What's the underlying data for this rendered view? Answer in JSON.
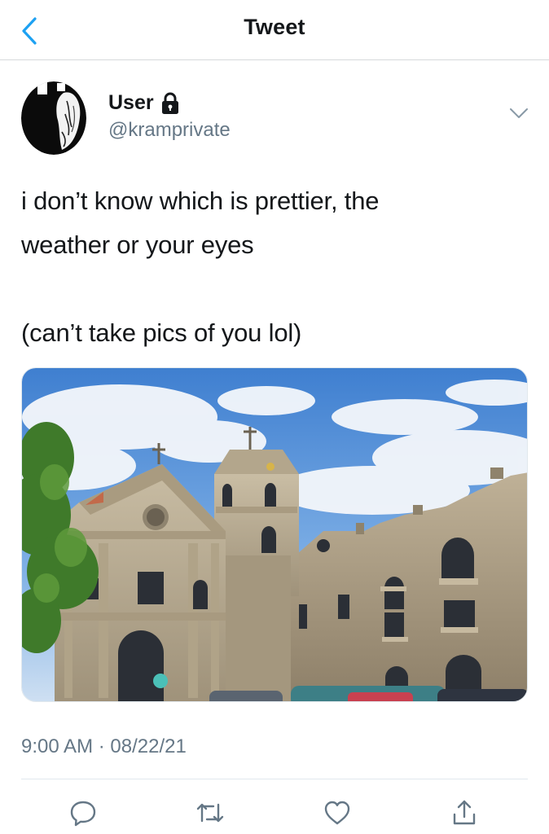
{
  "header": {
    "title": "Tweet",
    "back_icon": "chevron-left-icon"
  },
  "author": {
    "name": "User",
    "handle": "@kramprivate",
    "protected_icon": "lock-icon"
  },
  "tweet": {
    "lines": [
      "i don’t know which is prettier, the",
      "weather or your eyes",
      "",
      "(can’t take pics of you lol)"
    ],
    "timestamp": "9:00 AM · 08/22/21"
  },
  "actions": [
    {
      "icon": "reply-icon"
    },
    {
      "icon": "retweet-icon"
    },
    {
      "icon": "like-icon"
    },
    {
      "icon": "share-icon"
    }
  ],
  "colors": {
    "accent": "#1da1f2",
    "secondary_text": "#657786",
    "divider": "#e1e8ed"
  }
}
